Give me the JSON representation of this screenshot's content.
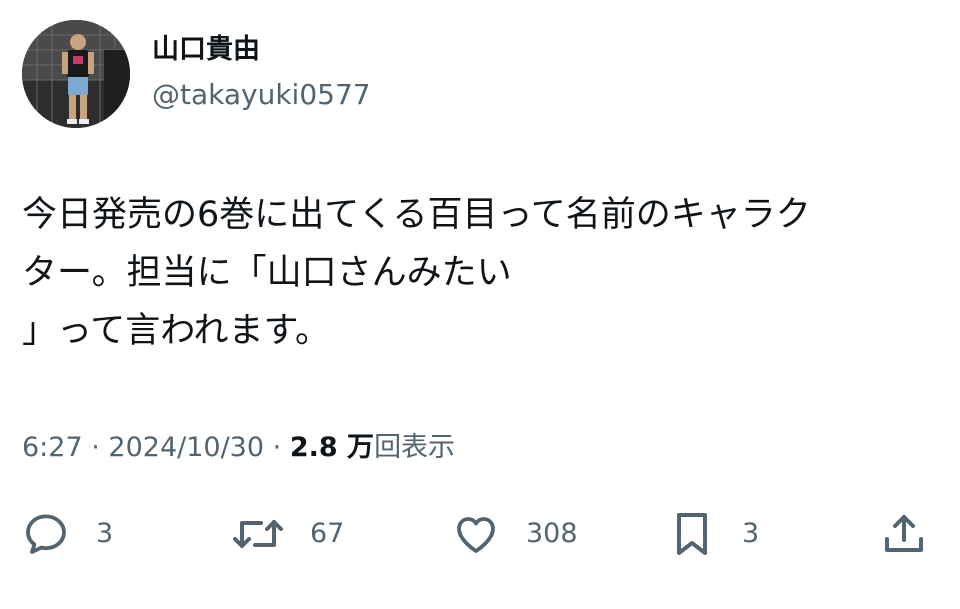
{
  "author": {
    "display_name": "山口貴由",
    "handle": "@takayuki0577",
    "avatar": "profile-photo"
  },
  "tweet": {
    "lines": [
      "今日発売の6巻に出てくる百目って名前のキャラク",
      "ター。担当に「山口さんみたい",
      "」って言われます。"
    ]
  },
  "meta": {
    "time": "6:27",
    "date": "2024/10/30",
    "separator": "·",
    "views_count": "2.8 万",
    "views_label": "回表示"
  },
  "actions": {
    "reply": {
      "icon": "reply-icon",
      "count": "3"
    },
    "retweet": {
      "icon": "retweet-icon",
      "count": "67"
    },
    "like": {
      "icon": "heart-icon",
      "count": "308"
    },
    "bookmark": {
      "icon": "bookmark-icon",
      "count": "3"
    },
    "share": {
      "icon": "share-icon"
    }
  },
  "colors": {
    "text": "#0f1419",
    "secondary": "#536471",
    "background": "#ffffff"
  }
}
